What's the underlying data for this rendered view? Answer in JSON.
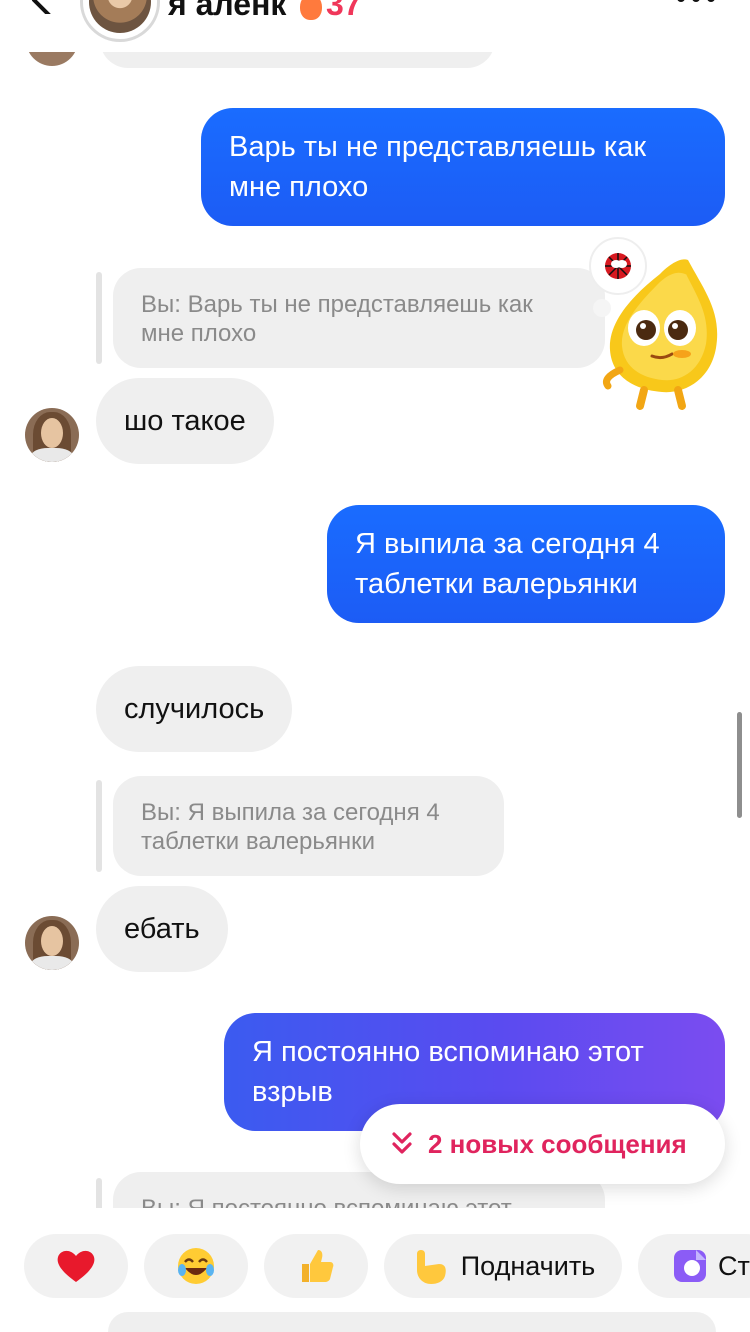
{
  "header": {
    "name": "я аленк",
    "streak_count": "37"
  },
  "messages": [
    {
      "type": "sent",
      "text": "Варь ты не представляешь как мне плохо"
    },
    {
      "type": "reply_quote",
      "text": "Вы: Варь ты не представляешь как мне плохо"
    },
    {
      "type": "received",
      "text": "шо такое"
    },
    {
      "type": "sent",
      "text": "Я выпила за сегодня 4 таблетки валерьянки"
    },
    {
      "type": "received",
      "text": "случилось"
    },
    {
      "type": "reply_quote",
      "text": "Вы: Я выпила за сегодня 4 таблетки валерьянки"
    },
    {
      "type": "received",
      "text": "ебать"
    },
    {
      "type": "sent",
      "text": "Я постоянно вспоминаю этот взрыв"
    },
    {
      "type": "reply_quote",
      "text": "Вы: Я постоянно вспоминаю этот"
    }
  ],
  "new_messages": {
    "label": "2 новых сообщения"
  },
  "quick_replies": [
    {
      "icon": "heart-emoji",
      "label": ""
    },
    {
      "icon": "laughing-emoji",
      "label": ""
    },
    {
      "icon": "thumbs-up-emoji",
      "label": ""
    },
    {
      "icon": "pointing-hand-emoji",
      "label": "Подначить"
    },
    {
      "icon": "sticker-icon",
      "label": "Ст"
    }
  ],
  "colors": {
    "sent_bubble": "#1c63fa",
    "received_bubble": "#efefef",
    "accent_red": "#e0245e"
  }
}
